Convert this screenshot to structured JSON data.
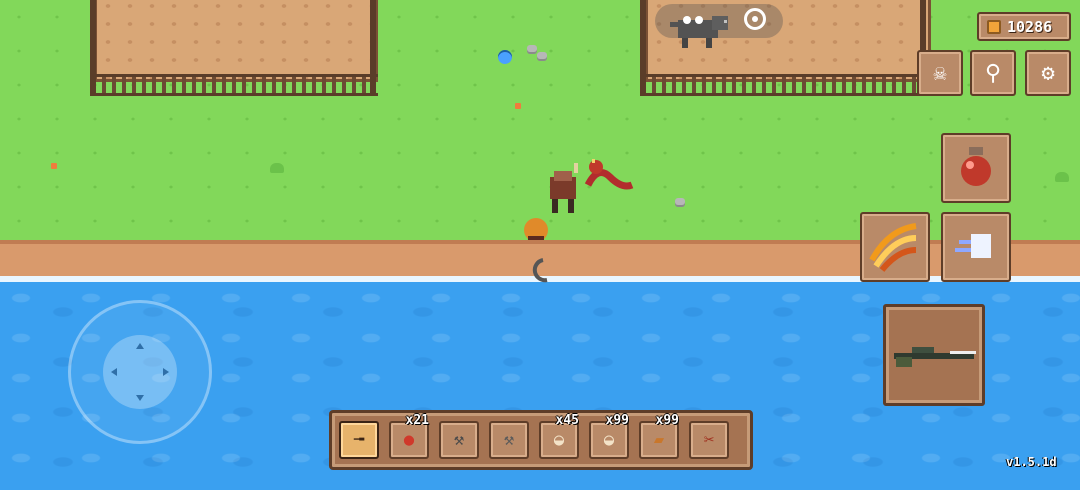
{
  "currency": {
    "icon": "coin-icon",
    "value": "10286"
  },
  "top_buttons": [
    {
      "name": "skull-icon",
      "glyph": "☠"
    },
    {
      "name": "loot-bag-icon",
      "glyph": "⚲"
    },
    {
      "name": "settings-gear-icon",
      "glyph": "⚙"
    }
  ],
  "minimap": {
    "creature_icon": "wolf-icon",
    "target_icon": "target-icon"
  },
  "skills": [
    {
      "name": "health-potion-icon"
    },
    {
      "name": "claw-slash-icon"
    },
    {
      "name": "dash-ghost-icon"
    }
  ],
  "hotbar": [
    {
      "name": "rifle-slot-icon",
      "count": "",
      "selected": true,
      "glyph": "╼"
    },
    {
      "name": "mushroom-slot-icon",
      "count": "x21",
      "selected": false,
      "glyph": "●"
    },
    {
      "name": "shovel-slot-icon",
      "count": "",
      "selected": false,
      "glyph": "⚒"
    },
    {
      "name": "axe-slot-icon",
      "count": "",
      "selected": false,
      "glyph": "⚒"
    },
    {
      "name": "food-bowl-slot-icon",
      "count": "x45",
      "selected": false,
      "glyph": "◒"
    },
    {
      "name": "food-bowl-2-slot-icon",
      "count": "x99",
      "selected": false,
      "glyph": "◒"
    },
    {
      "name": "bread-slot-icon",
      "count": "x99",
      "selected": false,
      "glyph": "▰"
    },
    {
      "name": "tongs-slot-icon",
      "count": "",
      "selected": false,
      "glyph": "✂"
    }
  ],
  "equipped_weapon": {
    "name": "sniper-rifle-icon"
  },
  "version": "v1.5.1d",
  "colors": {
    "grass": "#82d85a",
    "water": "#3aa0f0",
    "wood": "#a57352",
    "shore": "#d99a6c"
  }
}
